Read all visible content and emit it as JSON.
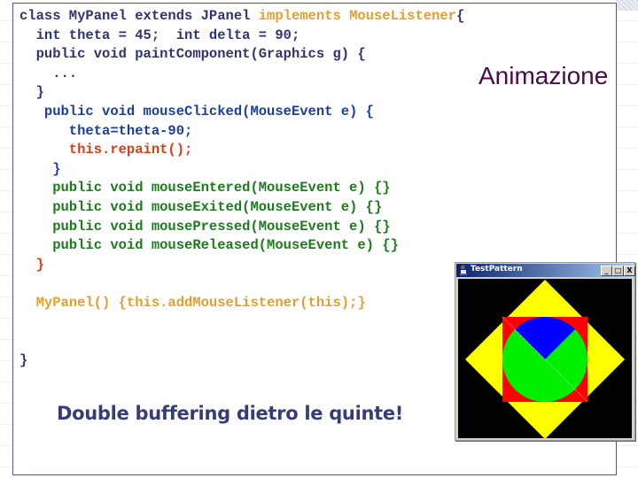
{
  "slide": {
    "title": "Animazione",
    "subtitle": "Double buffering dietro le quinte!",
    "code_lines": [
      {
        "segments": [
          {
            "text": "class MyPanel extends JPanel ",
            "color": "navy"
          },
          {
            "text": "implements MouseListener",
            "color": "orange"
          },
          {
            "text": "{",
            "color": "navy"
          }
        ]
      },
      {
        "segments": [
          {
            "text": "  int theta = 45;  int delta = 90;",
            "color": "navy"
          }
        ]
      },
      {
        "segments": [
          {
            "text": "  public void paintComponent(Graphics g) {",
            "color": "navy"
          }
        ]
      },
      {
        "segments": [
          {
            "text": "    ...",
            "color": "navy"
          }
        ]
      },
      {
        "segments": [
          {
            "text": "  }",
            "color": "navy"
          }
        ]
      },
      {
        "segments": [
          {
            "text": "   public void mouseClicked(MouseEvent e) {",
            "color": "blue"
          }
        ]
      },
      {
        "segments": [
          {
            "text": "      theta=theta-90;",
            "color": "blue"
          }
        ]
      },
      {
        "segments": [
          {
            "text": "      this.repaint();",
            "color": "red"
          }
        ]
      },
      {
        "segments": [
          {
            "text": "    }",
            "color": "blue"
          }
        ]
      },
      {
        "segments": [
          {
            "text": "    public void mouseEntered(MouseEvent e) {}",
            "color": "green"
          }
        ]
      },
      {
        "segments": [
          {
            "text": "    public void mouseExited(MouseEvent e) {}",
            "color": "green"
          }
        ]
      },
      {
        "segments": [
          {
            "text": "    public void mousePressed(MouseEvent e) {}",
            "color": "green"
          }
        ]
      },
      {
        "segments": [
          {
            "text": "    public void mouseReleased(MouseEvent e) {}",
            "color": "green"
          }
        ]
      },
      {
        "segments": [
          {
            "text": "  }",
            "color": "red"
          }
        ]
      },
      {
        "segments": [
          {
            "text": "",
            "color": "navy"
          }
        ]
      },
      {
        "segments": [
          {
            "text": "  MyPanel() {this.addMouseListener(this);}",
            "color": "orange"
          }
        ]
      },
      {
        "segments": [
          {
            "text": "",
            "color": "navy"
          }
        ]
      },
      {
        "segments": [
          {
            "text": "",
            "color": "navy"
          }
        ]
      },
      {
        "segments": [
          {
            "text": "}",
            "color": "navy"
          }
        ]
      }
    ]
  },
  "java_window": {
    "title": "TestPattern",
    "minimize_label": "_",
    "maximize_label": "□",
    "close_label": "X",
    "shape_colors": {
      "background": "#000000",
      "diamond": "#ffff00",
      "square": "#ff0000",
      "circle": "#00ee00",
      "arc": "#0000ff"
    },
    "arc_start_angle_deg": 45,
    "arc_extent_deg": 90
  },
  "colors": {
    "navy": "#2f3470",
    "blue": "#1c3f99",
    "red": "#d4401c",
    "green": "#1e7a1e",
    "orange": "#e0a030",
    "title": "#4a0a4a",
    "subtitle": "#363c78"
  }
}
